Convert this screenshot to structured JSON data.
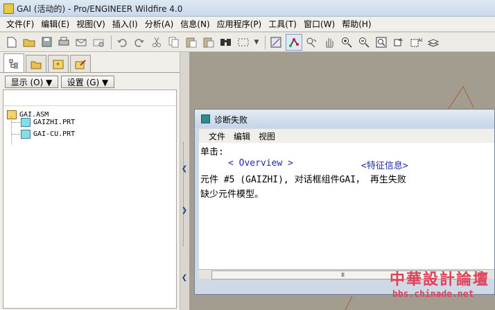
{
  "window": {
    "title": "GAI (活动的) - Pro/ENGINEER Wildfire 4.0"
  },
  "menubar": [
    "文件(F)",
    "编辑(E)",
    "视图(V)",
    "插入(I)",
    "分析(A)",
    "信息(N)",
    "应用程序(P)",
    "工具(T)",
    "窗口(W)",
    "帮助(H)"
  ],
  "toolbar": {
    "icons": [
      "new-file-icon",
      "open-folder-icon",
      "save-icon",
      "print-icon",
      "send-mail-icon",
      "mail-icon",
      "undo-icon",
      "redo-icon",
      "cut-icon",
      "copy-icon",
      "paste-icon",
      "paste-special-icon",
      "find-icon",
      "select-box-icon",
      "dropdown-icon",
      "repaint-icon",
      "spin-center-icon",
      "orient-icon",
      "pan-hand-icon",
      "zoom-in-icon",
      "zoom-out-icon",
      "refit-icon",
      "datum-planes-icon",
      "datum-axes-icon",
      "layers-icon"
    ]
  },
  "left_panel": {
    "tabs": [
      "model-tree-tab",
      "folder-browser-tab",
      "favorites-tab",
      "connections-tab"
    ],
    "show_button": "显示 (O) ▼",
    "settings_button": "设置 (G) ▼",
    "tree": [
      {
        "label": "GAI.ASM",
        "level": 0
      },
      {
        "label": "GAIZHI.PRT",
        "level": 1
      },
      {
        "label": "GAI-CU.PRT",
        "level": 1
      }
    ]
  },
  "dialog": {
    "title": "诊断失败",
    "menu": [
      "文件",
      "编辑",
      "视图"
    ],
    "click_label": "单击:",
    "overview_link": "< Overview >",
    "feature_info_link": "<特征信息>",
    "message_line1": "元件 #5 (GAIZHI), 对话框组件GAI， 再生失败",
    "message_line2": "缺少元件模型。",
    "scroll_grip": "III"
  },
  "watermark": {
    "title": "中華設計論壇",
    "url": "bbs.chinade.net"
  }
}
